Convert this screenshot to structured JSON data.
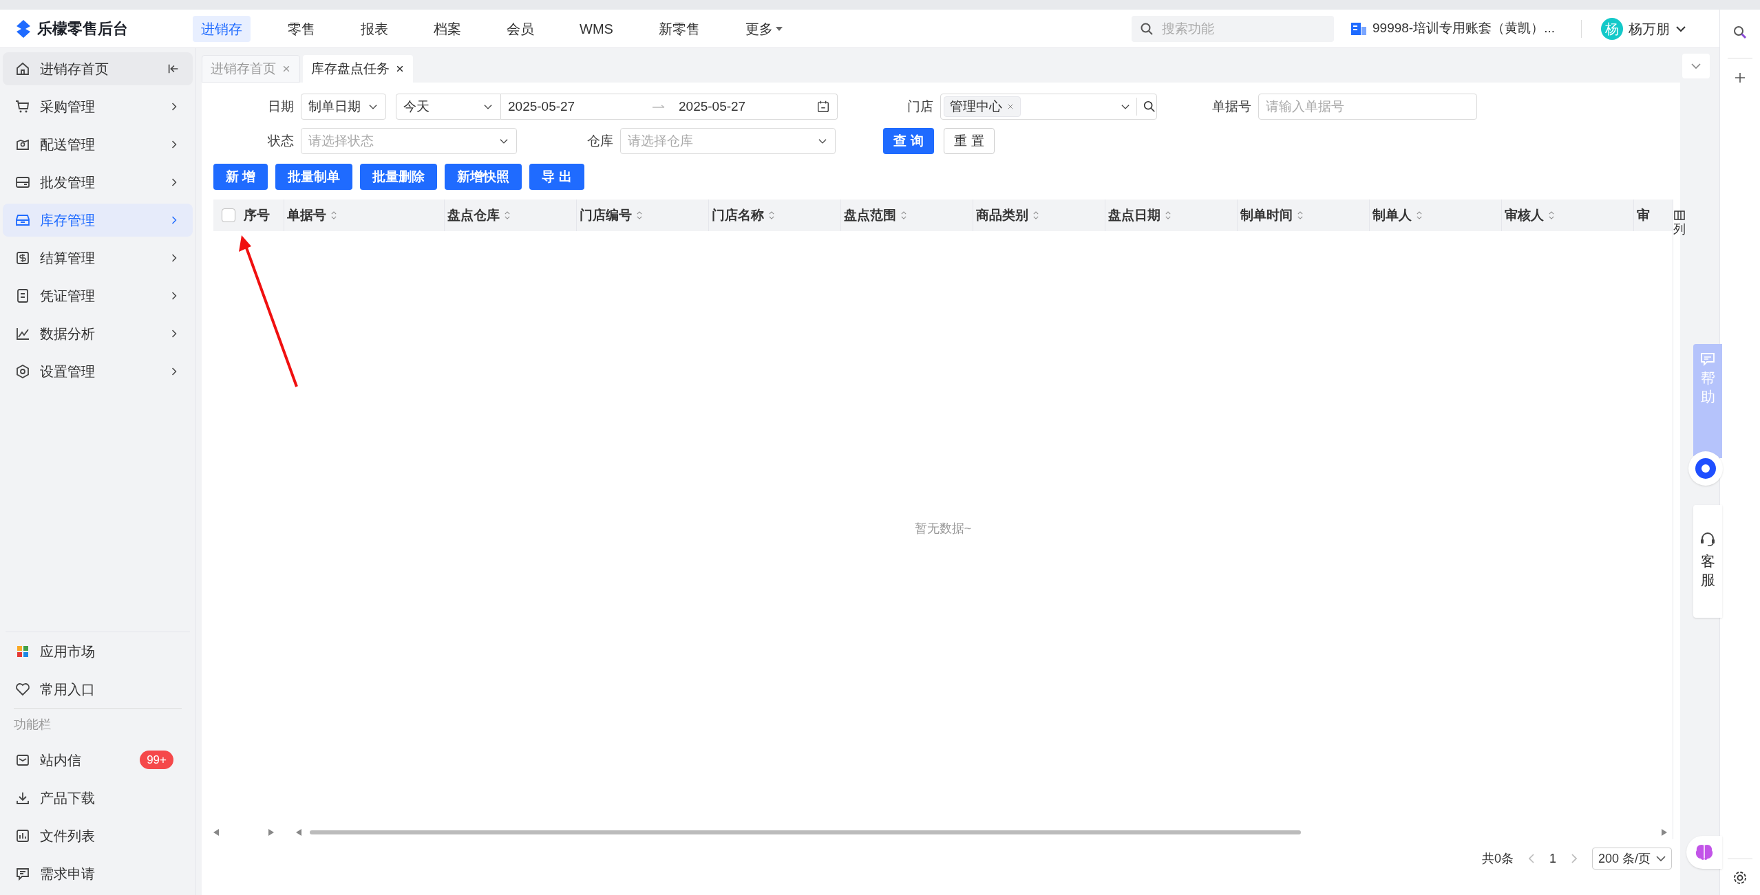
{
  "header": {
    "logo_text": "乐檬零售后台",
    "search_placeholder": "搜索功能",
    "account": "99998-培训专用账套（黄凯）...",
    "user_avatar": "杨",
    "user_name": "杨万朋",
    "nav": [
      {
        "label": "进销存",
        "selected": true
      },
      {
        "label": "零售",
        "selected": false
      },
      {
        "label": "报表",
        "selected": false
      },
      {
        "label": "档案",
        "selected": false
      },
      {
        "label": "会员",
        "selected": false
      },
      {
        "label": "WMS",
        "selected": false
      },
      {
        "label": "新零售",
        "selected": false
      },
      {
        "label": "更多",
        "selected": false,
        "kind": "dropdown"
      }
    ]
  },
  "sidebar": {
    "items": [
      {
        "label": "进销存首页",
        "kind": "home",
        "selected": false
      },
      {
        "label": "采购管理",
        "kind": "group",
        "selected": false
      },
      {
        "label": "配送管理",
        "kind": "group",
        "selected": false
      },
      {
        "label": "批发管理",
        "kind": "group",
        "selected": false
      },
      {
        "label": "库存管理",
        "kind": "group",
        "selected": true
      },
      {
        "label": "结算管理",
        "kind": "group",
        "selected": false
      },
      {
        "label": "凭证管理",
        "kind": "group",
        "selected": false
      },
      {
        "label": "数据分析",
        "kind": "group",
        "selected": false
      },
      {
        "label": "设置管理",
        "kind": "group",
        "selected": false
      }
    ],
    "shortcuts": [
      {
        "label": "应用市场"
      },
      {
        "label": "常用入口"
      }
    ],
    "section_label": "功能栏",
    "tools": [
      {
        "label": "站内信",
        "badge": "99+"
      },
      {
        "label": "产品下载"
      },
      {
        "label": "文件列表"
      },
      {
        "label": "需求申请"
      }
    ]
  },
  "tabs": [
    {
      "label": "进销存首页",
      "selected": false
    },
    {
      "label": "库存盘点任务",
      "selected": true
    }
  ],
  "filters": {
    "date_label": "日期",
    "date_type": "制单日期",
    "date_preset": "今天",
    "date_start": "2025-05-27",
    "date_end": "2025-05-27",
    "store_label": "门店",
    "store_tag": "管理中心",
    "doc_label": "单据号",
    "doc_placeholder": "请输入单据号",
    "status_label": "状态",
    "status_placeholder": "请选择状态",
    "warehouse_label": "仓库",
    "warehouse_placeholder": "请选择仓库",
    "query_button": "查 询",
    "reset_button": "重 置"
  },
  "actions": [
    "新 增",
    "批量制单",
    "批量删除",
    "新增快照",
    "导 出"
  ],
  "table": {
    "select_all_checked": false,
    "columns": [
      "序号",
      "单据号",
      "盘点仓库",
      "门店编号",
      "门店名称",
      "盘点范围",
      "商品类别",
      "盘点日期",
      "制单时间",
      "制单人",
      "审核人",
      "审"
    ],
    "column_settings": "列",
    "empty_text": "暂无数据~"
  },
  "pagination": {
    "total": "共0条",
    "page": "1",
    "page_size": "200 条/页"
  },
  "floating": {
    "help": "帮助",
    "service": "客服"
  }
}
